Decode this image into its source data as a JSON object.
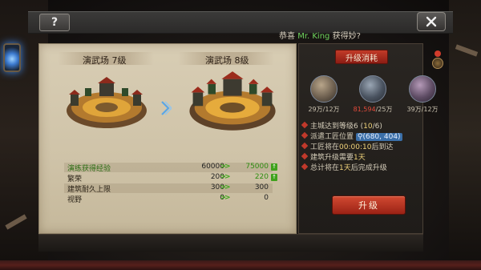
{
  "window": {
    "help_label": "?",
    "close_label": "✕"
  },
  "notice": {
    "prefix": "恭喜",
    "player": "Mr. King",
    "suffix": "获得妙?"
  },
  "current": {
    "title": "演武场  7级"
  },
  "next": {
    "title": "演武场  8级"
  },
  "stats": [
    {
      "label": "演练获得经验",
      "current": "60000",
      "arrows": ">>",
      "next": "75000",
      "increased": true
    },
    {
      "label": "繁荣",
      "current": "200",
      "arrows": ">>",
      "next": "220",
      "increased": true
    },
    {
      "label": "建筑耐久上限",
      "current": "300",
      "arrows": ">>",
      "next": "300",
      "increased": false
    },
    {
      "label": "视野",
      "current": "0",
      "arrows": ">>",
      "next": "0",
      "increased": false
    }
  ],
  "cost": {
    "title": "升级消耗",
    "resources": [
      {
        "icon": "wood-icon",
        "have": "29万",
        "need": "/12万",
        "insufficient": false
      },
      {
        "icon": "iron-icon",
        "have": "81,594",
        "need": "/25万",
        "insufficient": true
      },
      {
        "icon": "stone-icon",
        "have": "39万",
        "need": "/12万",
        "insufficient": false
      }
    ]
  },
  "requirements": [
    {
      "text_a": "主城达到等级6 (",
      "hl": "10",
      "text_b": "/6)"
    },
    {
      "text_a": "派遣工匠位置 ",
      "coord": "(680, 404)"
    },
    {
      "text_a": "工匠将在",
      "hl": "00:00:10",
      "text_b": "后到达"
    },
    {
      "text_a": "建筑升级需要",
      "hl": "1天",
      "text_b": ""
    },
    {
      "text_a": "总计将在",
      "hl": "1天",
      "text_b": "后完成升级"
    }
  ],
  "upgrade_button": "升级",
  "colors": {
    "accent_green": "#3fa11c",
    "accent_red": "#c23b28",
    "insufficient": "#e24a3a",
    "coord_bg": "#3b6fa8"
  }
}
